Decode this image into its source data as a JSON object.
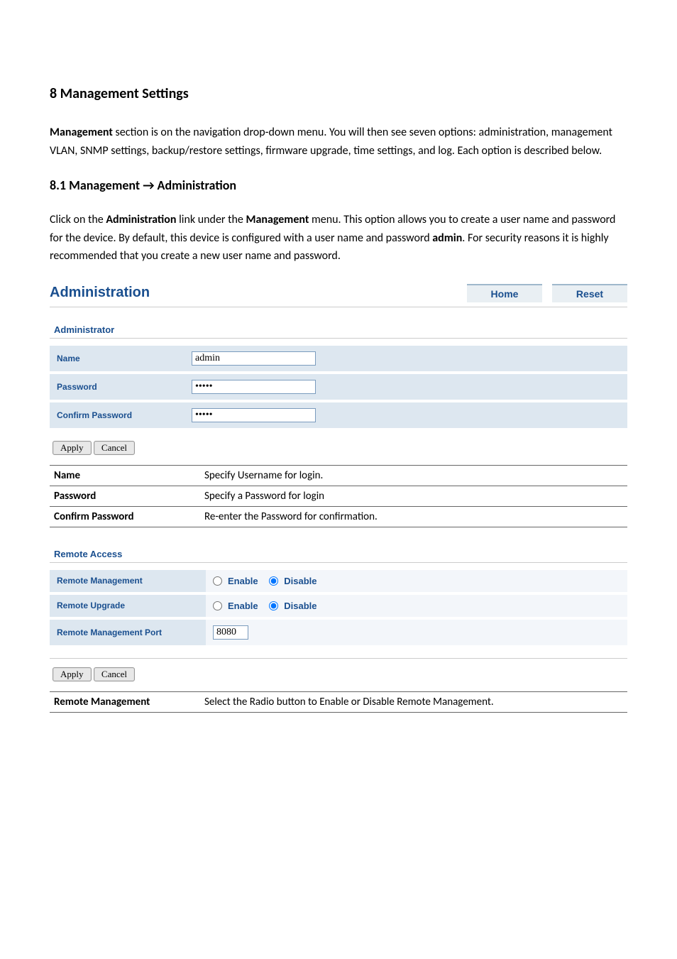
{
  "headings": {
    "h1": "8 Management Settings",
    "h2": "8.1 Management → Administration"
  },
  "paragraphs": {
    "intro_prefix_bold": "Management",
    "intro_rest": " section is on the navigation drop-down menu. You will then see seven options: administration, management VLAN, SNMP settings, backup/restore settings, firmware upgrade, time settings, and log. Each option is described below.",
    "admin_a": "Click on the ",
    "admin_b_bold": "Administration",
    "admin_c": " link under the ",
    "admin_d_bold": "Management",
    "admin_e": " menu. This option allows you to create a user name and password for the device. By default, this device is configured with a user name and password ",
    "admin_f_bold": "admin",
    "admin_g": ". For security reasons it is highly recommended that you create a new user name and password."
  },
  "panel": {
    "title": "Administration",
    "home": "Home",
    "reset": "Reset"
  },
  "administrator": {
    "section_label": "Administrator",
    "name_label": "Name",
    "name_value": "admin",
    "password_label": "Password",
    "password_value": "•••••",
    "confirm_label": "Confirm Password",
    "confirm_value": "•••••",
    "apply": "Apply",
    "cancel": "Cancel"
  },
  "desc_admin": {
    "name_k": "Name",
    "name_v": "Specify Username for login.",
    "password_k": "Password",
    "password_v": "Specify a Password for login",
    "confirm_k": "Confirm Password",
    "confirm_v": "Re-enter the Password for confirmation."
  },
  "remote": {
    "section_label": "Remote Access",
    "mgmt_label": "Remote Management",
    "upgrade_label": "Remote Upgrade",
    "port_label": "Remote Management Port",
    "port_value": "8080",
    "enable": "Enable",
    "disable": "Disable",
    "apply": "Apply",
    "cancel": "Cancel"
  },
  "desc_remote": {
    "mgmt_k": "Remote Management",
    "mgmt_v": "Select the Radio button to Enable or Disable Remote Management."
  }
}
